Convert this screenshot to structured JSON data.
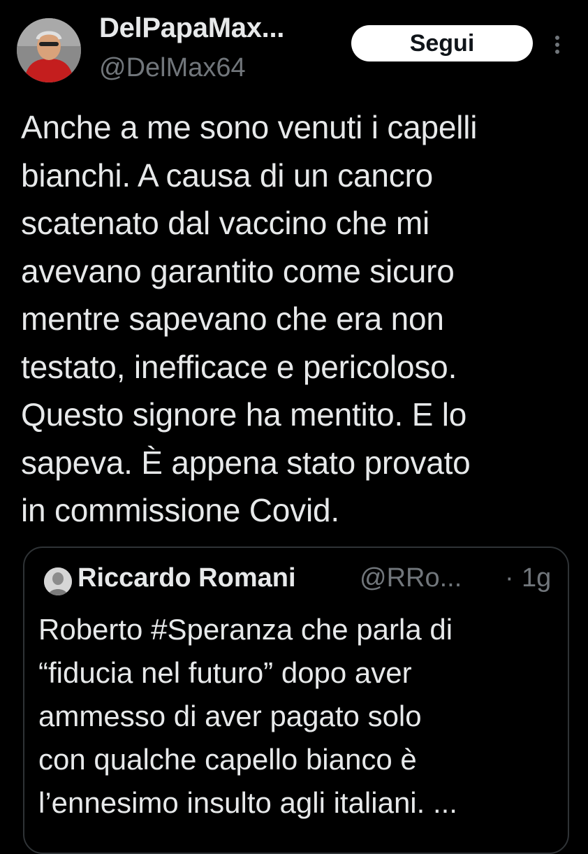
{
  "tweet": {
    "author": {
      "display_name": "DelPapaMax...",
      "handle": "@DelMax64",
      "avatar_icon": "user-avatar"
    },
    "follow_label": "Segui",
    "more_icon": "more-vertical-icon",
    "text": "Anche a me sono venuti i capelli\nbianchi. A causa di un cancro\nscatenato dal vaccino che mi\navevano garantito come sicuro\nmentre sapevano che era non\ntestato, inefficace e pericoloso.\nQuesto signore ha mentito. E lo\nsapeva. È appena stato provato\nin commissione Covid."
  },
  "quote": {
    "author": {
      "display_name": "Riccardo Romani",
      "handle": "@RRo...",
      "avatar_icon": "user-avatar"
    },
    "separator": "·",
    "time": "1g",
    "text": "Roberto #Speranza che parla di\n“fiducia nel futuro” dopo aver\nammesso di aver pagato solo\ncon qualche capello bianco è\nl’ennesimo insulto agli italiani. ..."
  },
  "colors": {
    "background": "#000000",
    "text_primary": "#e7e9ea",
    "text_secondary": "#71767b",
    "border": "#2f3336",
    "button_bg": "#ffffff"
  }
}
